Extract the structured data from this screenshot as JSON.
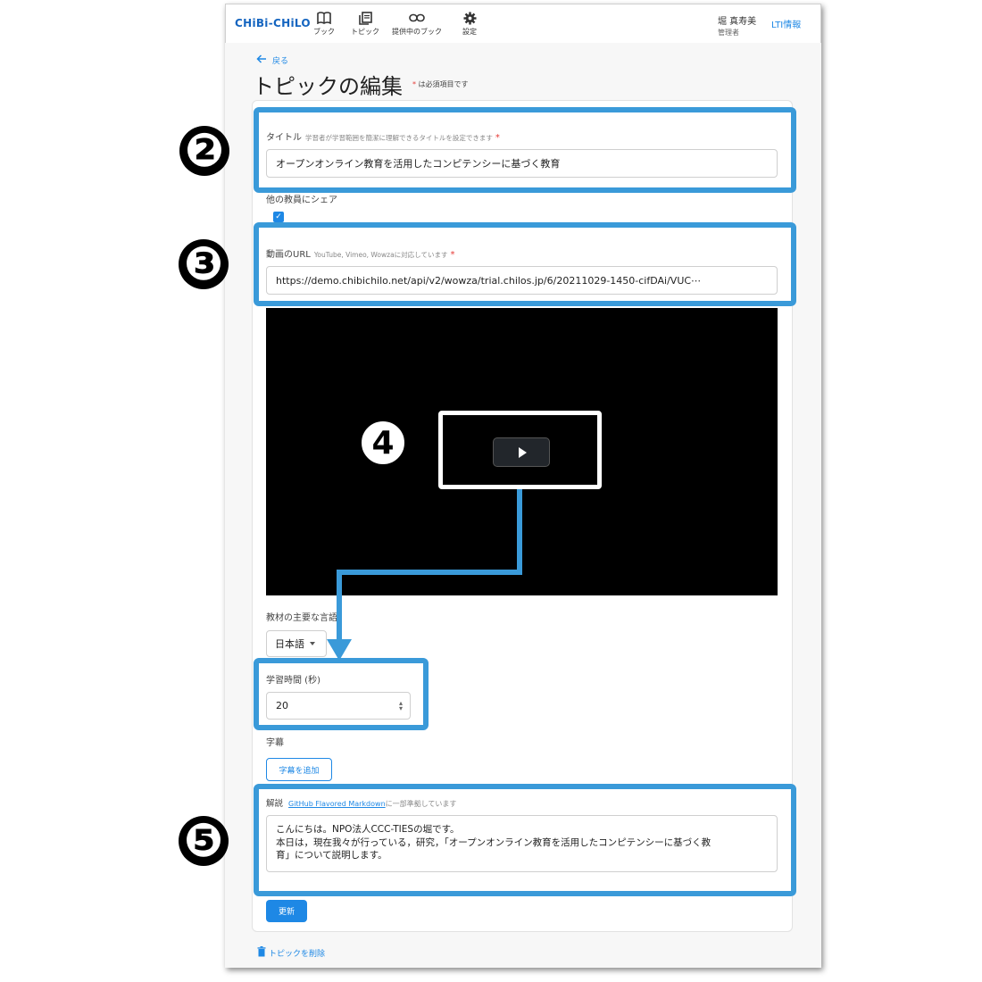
{
  "header": {
    "logo": "CHiBi-CHiLO",
    "nav": [
      {
        "label": "ブック",
        "icon": "book-icon"
      },
      {
        "label": "トピック",
        "icon": "topic-icon"
      },
      {
        "label": "提供中のブック",
        "icon": "link-icon"
      },
      {
        "label": "設定",
        "icon": "gear-icon"
      }
    ],
    "user_name": "堀 真寿美",
    "user_role": "管理者",
    "lti_link": "LTI情報"
  },
  "page": {
    "back_label": "戻る",
    "title": "トピックの編集",
    "required_note": "は必須項目です"
  },
  "form": {
    "title_label": "タイトル",
    "title_hint": "学習者が学習範囲を簡潔に理解できるタイトルを設定できます",
    "title_value": "オープンオンライン教育を活用したコンピテンシーに基づく教育",
    "share_label": "他の教員にシェア",
    "share_checked": true,
    "video_url_label": "動画のURL",
    "video_url_hint": "YouTube, Vimeo, Wowzaに対応しています",
    "video_url_value": "https://demo.chibichilo.net/api/v2/wowza/trial.chilos.jp/6/20211029-1450-cifDAi/VUC⋯",
    "language_label": "教材の主要な言語",
    "language_value": "日本語",
    "duration_label": "学習時間 (秒)",
    "duration_value": "20",
    "subtitle_label": "字幕",
    "add_subtitle_button": "字幕を追加",
    "description_label": "解説",
    "description_link": "GitHub Flavored Markdown",
    "description_hint": "に一部準拠しています",
    "description_line1": "こんにちは。NPO法人CCC-TIESの堀です。",
    "description_line2": "本日は，現在我々が行っている，研究，「オープンオンライン教育を活用したコンピテンシーに基づく教",
    "description_line3": "育」について説明します。",
    "update_button": "更新",
    "delete_link": "トピックを削除"
  },
  "annotations": {
    "n2": "❷",
    "n3": "❸",
    "n4": "4",
    "n5": "❺",
    "highlight_color": "#3a9ad9"
  },
  "colors": {
    "accent": "#1e88e5",
    "required": "#e53935"
  }
}
